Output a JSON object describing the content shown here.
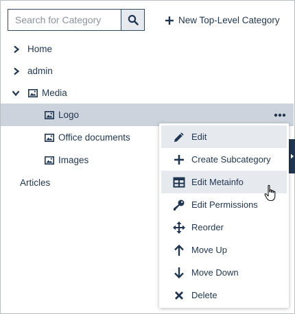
{
  "search": {
    "placeholder": "Search for Category"
  },
  "toolbar": {
    "new_top_level_label": "New Top-Level Category"
  },
  "tree": {
    "home": "Home",
    "admin": "admin",
    "media": "Media",
    "logo": "Logo",
    "office_documents": "Office documents",
    "images": "Images",
    "articles": "Articles"
  },
  "context_menu": {
    "items": [
      {
        "label": "Edit",
        "icon": "pencil-icon"
      },
      {
        "label": "Create Subcategory",
        "icon": "plus-icon"
      },
      {
        "label": "Edit Metainfo",
        "icon": "table-icon"
      },
      {
        "label": "Edit Permissions",
        "icon": "key-icon"
      },
      {
        "label": "Reorder",
        "icon": "move-arrows-icon"
      },
      {
        "label": "Move Up",
        "icon": "arrow-up-icon"
      },
      {
        "label": "Move Down",
        "icon": "arrow-down-icon"
      },
      {
        "label": "Delete",
        "icon": "x-icon"
      }
    ]
  },
  "colors": {
    "text": "#1f3550",
    "selected_row": "#cdd3dc",
    "highlight": "#e6e9ee",
    "side_tab": "#1f3550"
  }
}
